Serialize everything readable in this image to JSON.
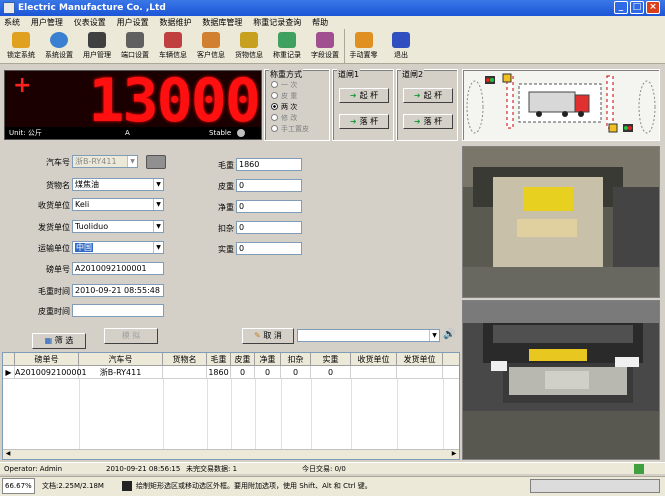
{
  "window": {
    "title": "Electric Manufacture Co. ,Ltd"
  },
  "menu": [
    "系统",
    "用户管理",
    "仪表设置",
    "用户设置",
    "数据维护",
    "数据库管理",
    "称重记录查询",
    "帮助"
  ],
  "toolbar": [
    {
      "label": "锁定系统",
      "icon": "lock-icon",
      "color": "#e0a020"
    },
    {
      "label": "系统设置",
      "icon": "globe-icon",
      "color": "#3a7fd0"
    },
    {
      "label": "用户管理",
      "icon": "user-icon",
      "color": "#404040"
    },
    {
      "label": "端口设置",
      "icon": "port-icon",
      "color": "#606060"
    },
    {
      "label": "车辆信息",
      "icon": "truck-icon",
      "color": "#c04040"
    },
    {
      "label": "客户信息",
      "icon": "people-icon",
      "color": "#d08030"
    },
    {
      "label": "货物信息",
      "icon": "goods-icon",
      "color": "#c8a020"
    },
    {
      "label": "称重记录",
      "icon": "record-icon",
      "color": "#40a060"
    },
    {
      "label": "字段设置",
      "icon": "field-icon",
      "color": "#a05090"
    },
    {
      "label": "手动置零",
      "icon": "zero-icon",
      "color": "#e09020"
    },
    {
      "label": "退出",
      "icon": "exit-icon",
      "color": "#3050c0"
    }
  ],
  "scale": {
    "display": "13000",
    "unit_label": "Unit: 公斤",
    "a_label": "A",
    "stable_label": "Stable",
    "sign": "+"
  },
  "weigh_mode": {
    "caption": "称重方式",
    "options": [
      {
        "label": "一 次",
        "selected": false
      },
      {
        "label": "皮 重",
        "selected": false
      },
      {
        "label": "两 次",
        "selected": true
      },
      {
        "label": "修 改",
        "selected": false
      },
      {
        "label": "手工置皮",
        "selected": false
      }
    ]
  },
  "gate1": {
    "caption": "道闸1",
    "up": "起 杆",
    "down": "落 杆"
  },
  "gate2": {
    "caption": "道闸2",
    "up": "起 杆",
    "down": "落 杆"
  },
  "form": {
    "plate_label": "汽车号",
    "plate_value": "浙B-RY411",
    "goods_label": "货物名",
    "goods_value": "煤焦油",
    "receiver_label": "收货单位",
    "receiver_value": "Keli",
    "sender_label": "发货单位",
    "sender_value": "Tuoliduo",
    "transport_label": "运输单位",
    "transport_value": "中国",
    "serial_label": "磅单号",
    "serial_value": "A2010092100001",
    "gross_time_label": "毛重时间",
    "gross_time_value": "2010-09-21 08:55:48",
    "tare_time_label": "皮重时间",
    "tare_time_value": "",
    "gross_label": "毛重",
    "gross_value": "1860",
    "tare_label": "皮重",
    "tare_value": "0",
    "net_label": "净重",
    "net_value": "0",
    "deduct_label": "扣杂",
    "deduct_value": "0",
    "real_label": "实重",
    "real_value": "0"
  },
  "buttons": {
    "filter": "筛 选",
    "simulate": "模 拟",
    "cancel": "取 消",
    "search_value": ""
  },
  "table": {
    "columns": [
      "磅单号",
      "汽车号",
      "货物名",
      "毛重",
      "皮重",
      "净重",
      "扣杂",
      "实重",
      "收货单位",
      "发货单位",
      ""
    ],
    "rows": [
      [
        "A2010092100001",
        "浙B-RY411",
        "",
        "1860",
        "0",
        "0",
        "0",
        "0",
        "",
        "",
        ""
      ]
    ]
  },
  "status": {
    "operator": "Operator: Admin",
    "datetime": "2010-09-21 08:56:15",
    "pending": "未完交易数据: 1",
    "today": "今日交易: 0/0"
  },
  "editor_status": {
    "zoom": "66.67%",
    "doc": "文档:2.25M/2.18M",
    "hint": "绘制矩形选区或移动选区外框。要用附加选项，使用 Shift、Alt 和 Ctrl 键。"
  }
}
